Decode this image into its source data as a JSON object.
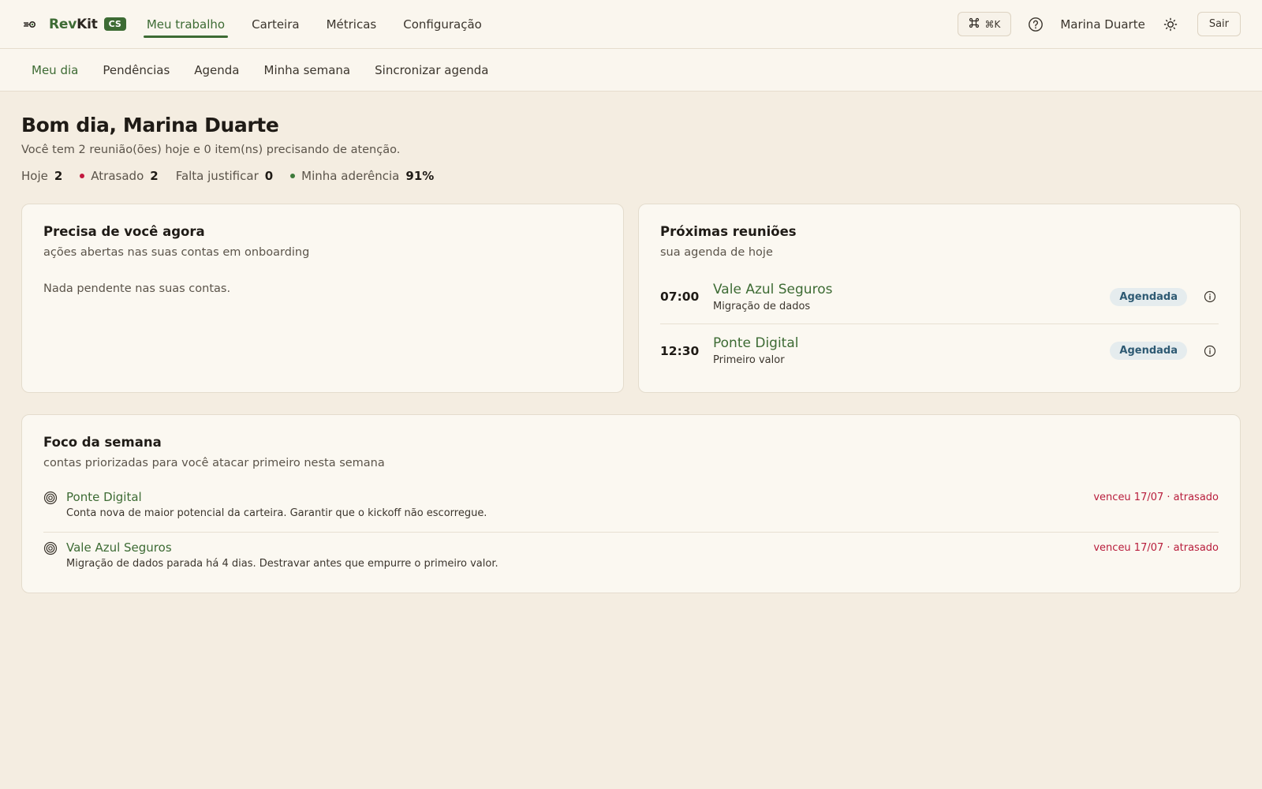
{
  "app": {
    "brand_prefix": "Rev",
    "brand_suffix": "Kit",
    "brand_badge": "CS"
  },
  "mainnav": {
    "items": [
      {
        "label": "Meu trabalho",
        "active": true
      },
      {
        "label": "Carteira",
        "active": false
      },
      {
        "label": "Métricas",
        "active": false
      },
      {
        "label": "Configuração",
        "active": false
      }
    ]
  },
  "topbar": {
    "command_shortcut": "⌘K",
    "user_name": "Marina Duarte",
    "logout_label": "Sair"
  },
  "subnav": {
    "items": [
      {
        "label": "Meu dia",
        "active": true
      },
      {
        "label": "Pendências",
        "active": false
      },
      {
        "label": "Agenda",
        "active": false
      },
      {
        "label": "Minha semana",
        "active": false
      },
      {
        "label": "Sincronizar agenda",
        "active": false
      }
    ]
  },
  "header": {
    "greeting": "Bom dia, Marina Duarte",
    "summary": "Você tem 2 reunião(ões) hoje e 0 item(ns) precisando de atenção."
  },
  "stats": {
    "today_label": "Hoje",
    "today_value": "2",
    "late_label": "Atrasado",
    "late_value": "2",
    "justify_label": "Falta justificar",
    "justify_value": "0",
    "adherence_label": "Minha aderência",
    "adherence_value": "91%"
  },
  "colors": {
    "accent": "#3d6b34",
    "late": "#c2183e",
    "adherence": "#3d7a3a",
    "badge_bg": "#e5ecee",
    "badge_text": "#2e5a73"
  },
  "needs_you": {
    "title": "Precisa de você agora",
    "subtitle": "ações abertas nas suas contas em onboarding",
    "empty_message": "Nada pendente nas suas contas."
  },
  "meetings": {
    "title": "Próximas reuniões",
    "subtitle": "sua agenda de hoje",
    "items": [
      {
        "time": "07:00",
        "account": "Vale Azul Seguros",
        "description": "Migração de dados",
        "status": "Agendada"
      },
      {
        "time": "12:30",
        "account": "Ponte Digital",
        "description": "Primeiro valor",
        "status": "Agendada"
      }
    ]
  },
  "focus": {
    "title": "Foco da semana",
    "subtitle": "contas priorizadas para você atacar primeiro nesta semana",
    "items": [
      {
        "account": "Ponte Digital",
        "description": "Conta nova de maior potencial da carteira. Garantir que o kickoff não escorregue.",
        "due": "venceu 17/07 · atrasado",
        "icon": "target-icon"
      },
      {
        "account": "Vale Azul Seguros",
        "description": "Migração de dados parada há 4 dias. Destravar antes que empurre o primeiro valor.",
        "due": "venceu 17/07 · atrasado",
        "icon": "target-icon"
      }
    ]
  }
}
